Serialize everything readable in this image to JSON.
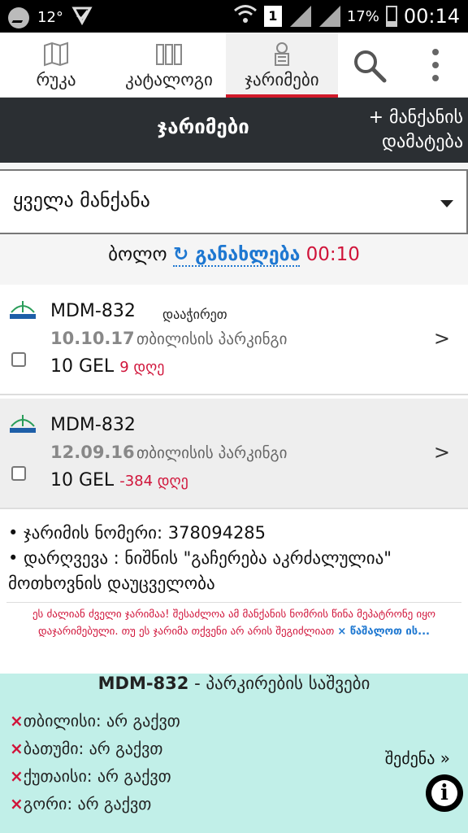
{
  "status_bar": {
    "temperature": "12°",
    "battery": "17%",
    "time": "00:14",
    "sim": "1"
  },
  "nav": {
    "tabs": [
      {
        "label": "რუკა",
        "icon": "map-icon"
      },
      {
        "label": "კატალოგი",
        "icon": "catalog-icon"
      },
      {
        "label": "ჯარიმები",
        "icon": "fines-icon"
      }
    ],
    "active_tab": 2
  },
  "header": {
    "title": "ჯარიმები",
    "add_car_line1": "+ მანქანის",
    "add_car_line2": "დამატება"
  },
  "filter": {
    "selected": "ყველა მანქანა"
  },
  "refresh": {
    "prefix": "ბოლო",
    "icon": "↻",
    "label": "განახლება",
    "time": "00:10"
  },
  "fines": [
    {
      "plate": "MDM-832",
      "status": "დააჭირეთ",
      "date": "10.10.17",
      "place": "თბილისის პარკინგი",
      "amount": "10 GEL",
      "days": "9 დღე",
      "arrow": ">"
    },
    {
      "plate": "MDM-832",
      "status": "",
      "date": "12.09.16",
      "place": "თბილისის პარკინგი",
      "amount": "10 GEL",
      "days": "-384 დღე",
      "arrow": ">"
    }
  ],
  "details": {
    "fine_number": "• ჯარიმის ნომერი: 378094285",
    "violation": "• დარღვევა : ნიშნის \"გაჩერება აკრძალულია\" მოთხოვნის დაუცველობა"
  },
  "warning": {
    "text": "ეს ძალიან ძველი ჯარიმაა! შესაძლოა ამ მანქანის ნომრის წინა მეპატრონე იყო დაჯარიმებული. თუ ეს ჯარიმა თქვენი არ არის შეგიძლიათ",
    "ignore_link": "× წაშალოთ ის..."
  },
  "parking_saves": {
    "plate": "MDM-832",
    "title_suffix": " - პარკირების საშვები",
    "cities": [
      "თბილისი: არ გაქვთ",
      "ბათუმი: არ გაქვთ",
      "ქუთაისი: არ გაქვთ",
      "გორი: არ გაქვთ"
    ],
    "buy_label": "შეძენა »",
    "info": "i"
  },
  "colors": {
    "header_bg": "#2b2f33",
    "accent_red": "#d11a2a",
    "link_blue": "#1f78d1",
    "saves_bg": "#c1efe8"
  }
}
